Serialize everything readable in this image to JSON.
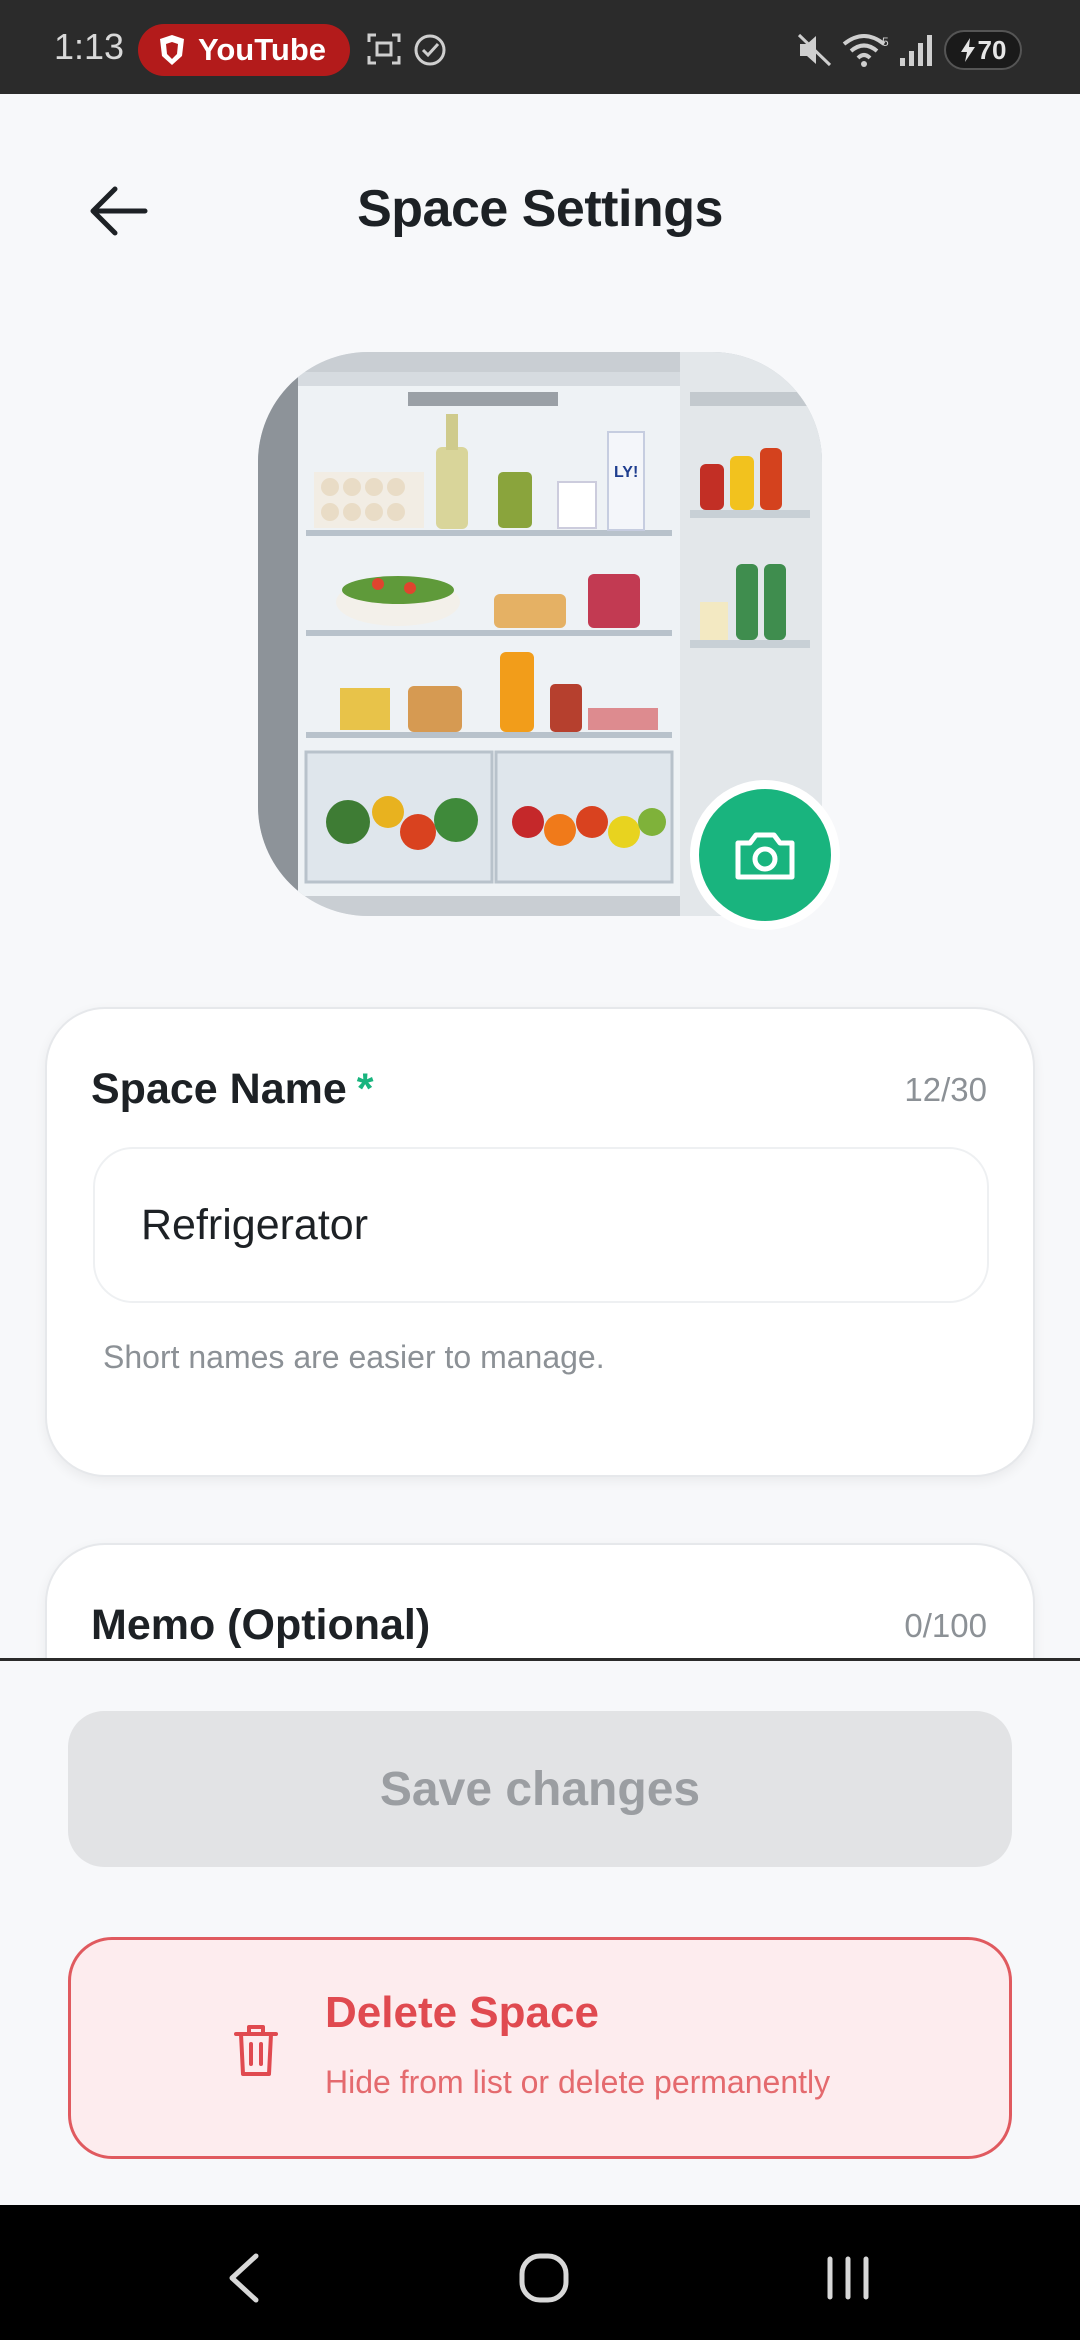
{
  "status_bar": {
    "time": "1:13",
    "app_pill": "YouTube",
    "battery": "70",
    "pill_color": "#b31b1b"
  },
  "header": {
    "title": "Space Settings",
    "back_icon": "arrow-left-icon"
  },
  "space_image": {
    "subject": "open refrigerator with shelves of food",
    "camera_icon": "camera-icon",
    "accent": "#19b47e"
  },
  "name_field": {
    "label": "Space Name",
    "required_mark": "*",
    "counter": "12/30",
    "value": "Refrigerator",
    "hint": "Short names are easier to manage."
  },
  "memo_field": {
    "label": "Memo (Optional)",
    "counter": "0/100"
  },
  "actions": {
    "save_label": "Save changes",
    "delete_title": "Delete Space",
    "delete_subtitle": "Hide from list or delete permanently",
    "delete_icon": "trash-icon",
    "danger_color": "#e04a50"
  },
  "nav_bar": {
    "back_icon": "nav-back-icon",
    "home_icon": "nav-home-icon",
    "recents_icon": "nav-recents-icon"
  }
}
